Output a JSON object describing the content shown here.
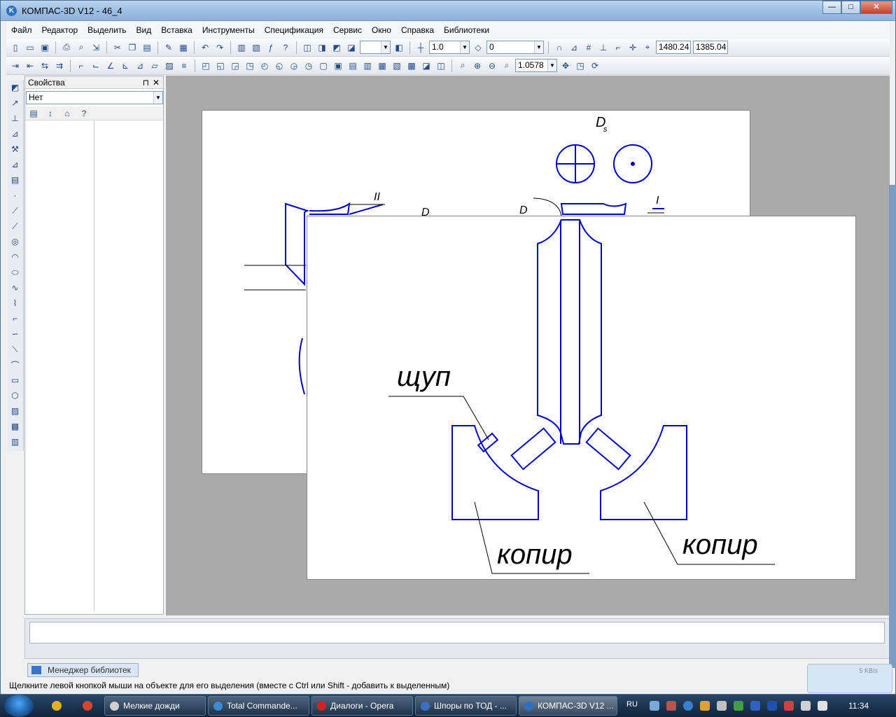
{
  "window": {
    "title": "КОМПАС-3D V12 - 46_4",
    "minimize": "—",
    "maximize": "□",
    "close": "✕"
  },
  "menu": {
    "items": [
      "Файл",
      "Редактор",
      "Выделить",
      "Вид",
      "Вставка",
      "Инструменты",
      "Спецификация",
      "Сервис",
      "Окно",
      "Справка",
      "Библиотеки"
    ]
  },
  "toolbar": {
    "line_scale": "1.0",
    "layer": "0",
    "coord_x": "1480.24",
    "coord_y": "1385.04",
    "zoom": "1.0578"
  },
  "properties_panel": {
    "title": "Свойства",
    "pin": "⊓",
    "close": "✕",
    "selection": "Нет"
  },
  "drawing": {
    "label_probe": "щуп",
    "label_copier_left": "копир",
    "label_copier_right": "копир",
    "label_ds": "D",
    "label_ds_sub": "s",
    "label_d2": "D",
    "label_d1": "D",
    "label_ii": "II",
    "label_i": "I"
  },
  "library_tab": {
    "label": "Менеджер библиотек"
  },
  "status": {
    "hint": "Щелкните левой кнопкой мыши на объекте для его выделения (вместе с Ctrl или Shift - добавить к выделенным)"
  },
  "net_meter": {
    "rate": "5 KB/s"
  },
  "taskbar": {
    "items": [
      {
        "label": "Мелкие дожди",
        "icon_color": "#d0d0d0"
      },
      {
        "label": "Total Commande...",
        "icon_color": "#3c8ad6"
      },
      {
        "label": "Диалоги - Opera",
        "icon_color": "#d62020"
      },
      {
        "label": "Шпоры по ТОД - ...",
        "icon_color": "#3a6fc2"
      },
      {
        "label": "КОМПАС-3D V12 ...",
        "icon_color": "#2d6fc2"
      }
    ],
    "language": "RU",
    "clock": "11:34"
  },
  "colors": {
    "drawing_line": "#0000cc",
    "workspace_bg": "#aaaaaa"
  }
}
